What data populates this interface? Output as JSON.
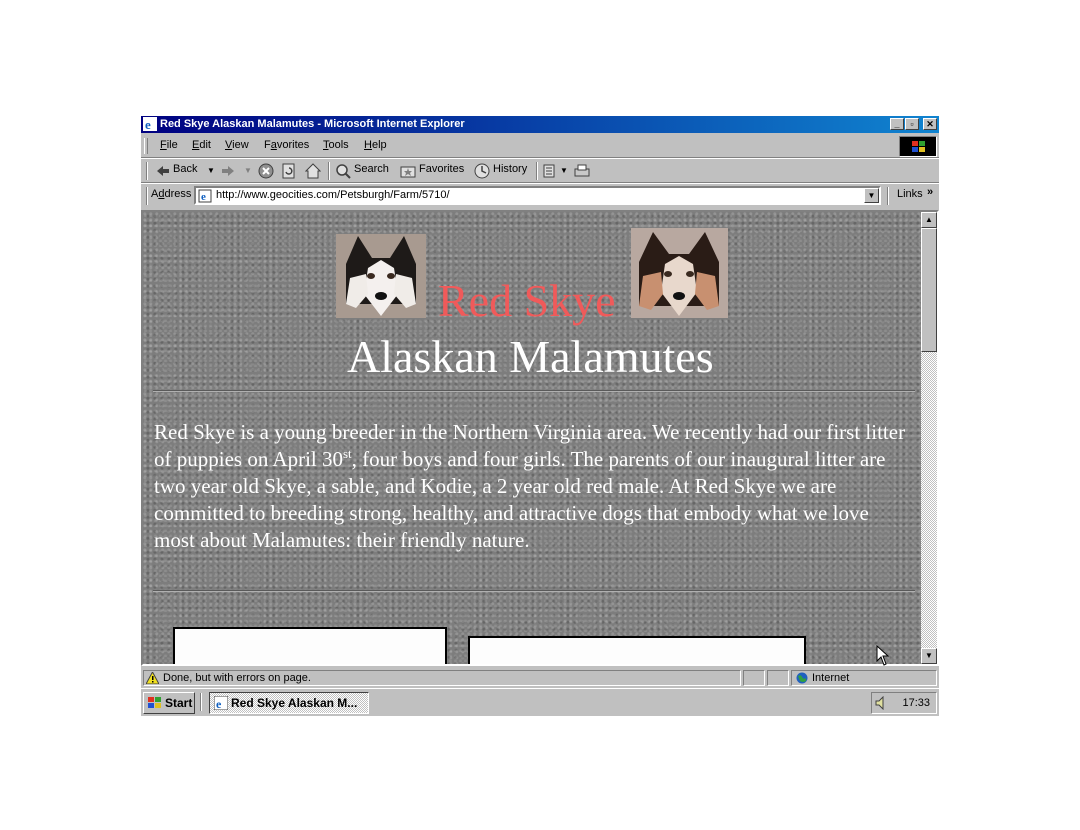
{
  "window": {
    "title": "Red Skye Alaskan Malamutes - Microsoft Internet Explorer",
    "controls": [
      "_",
      "▫",
      "✕"
    ]
  },
  "menu": {
    "items": [
      {
        "key": "F",
        "rest": "ile"
      },
      {
        "key": "E",
        "rest": "dit"
      },
      {
        "key": "V",
        "rest": "iew"
      },
      {
        "pre": "F",
        "key": "a",
        "rest": "vorites"
      },
      {
        "key": "T",
        "rest": "ools"
      },
      {
        "key": "H",
        "rest": "elp"
      }
    ]
  },
  "toolbar": {
    "back_label": "Back",
    "search_label": "Search",
    "favorites_label": "Favorites",
    "history_label": "History"
  },
  "address": {
    "label_pre": "A",
    "label_key": "d",
    "label_rest": "dress",
    "url": "http://www.geocities.com/Petsburgh/Farm/5710/",
    "links_label": "Links"
  },
  "page": {
    "title_red": "Red Skye",
    "title_white": "Alaskan Malamutes",
    "intro_part1": "Red Skye is a young breeder in the Northern Virginia area.  We recently had our first litter of puppies on April 30",
    "intro_sup": "st",
    "intro_part2": ", four boys and four girls.  The parents of our inaugural litter are two year old Skye, a sable, and Kodie, a 2 year old red male. At Red Skye we are committed to breeding strong, healthy, and attractive dogs that embody what we love most about Malamutes: their friendly nature."
  },
  "status": {
    "text": "Done, but with errors on page.",
    "zone": "Internet"
  },
  "taskbar": {
    "start_label": "Start",
    "task_label": "Red Skye Alaskan M...",
    "clock": "17:33"
  }
}
